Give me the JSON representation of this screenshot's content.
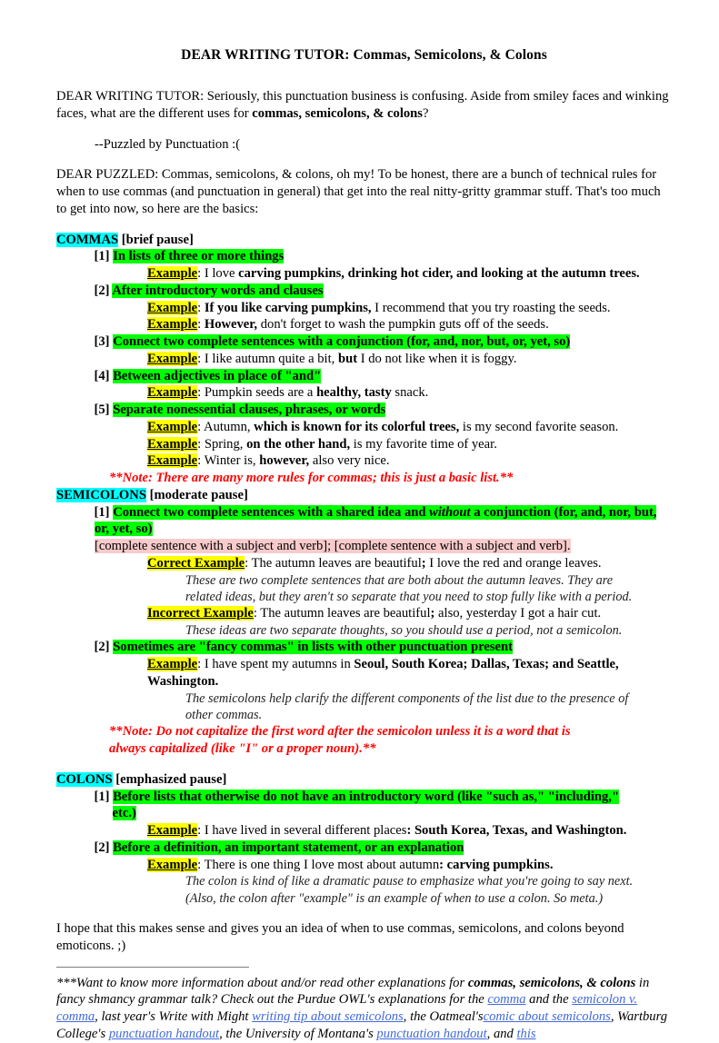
{
  "document": {
    "title": "DEAR WRITING TUTOR: Commas, Semicolons, & Colons",
    "intro": {
      "line1": "DEAR WRITING TUTOR: Seriously, this punctuation business is confusing.  Aside from smiley faces and winking faces, what are the different uses for ",
      "line1_bold": "commas, semicolons, & colons",
      "line1_end": "?",
      "signature": "--Puzzled by Punctuation :(",
      "answer": "DEAR PUZZLED: Commas, semicolons, & colons, oh my!  To be honest, there are a bunch of technical rules for when to use commas (and punctuation in general) that get into the real nitty-gritty grammar stuff.  That's too much to get into now, so here are the basics:"
    },
    "commas": {
      "heading": "COMMAS",
      "heading_suffix": " [brief pause]",
      "rules": [
        {
          "num": "[1]",
          "text": "In lists of three or more things",
          "examples": [
            {
              "label": "Example",
              "plain_pre": ": I love ",
              "bold": "carving pumpkins, drinking hot cider, and looking at the autumn trees.",
              "plain_post": ""
            }
          ]
        },
        {
          "num": "[2]",
          "text": "After introductory words and clauses",
          "examples": [
            {
              "label": "Example",
              "plain_pre": ": ",
              "bold": "If you like carving pumpkins,",
              "plain_post": " I recommend that you try roasting the seeds."
            },
            {
              "label": "Example",
              "plain_pre": ": ",
              "bold": "However,",
              "plain_post": " don't forget to wash the pumpkin guts off of the seeds."
            }
          ]
        },
        {
          "num": "[3]",
          "text": "Connect two complete sentences with a conjunction (for, and, nor, but, or, yet, so)",
          "examples": [
            {
              "label": "Example",
              "plain_pre": ": I like autumn quite a bit, ",
              "bold": "but",
              "plain_post": " I do not like when it is foggy."
            }
          ]
        },
        {
          "num": "[4]",
          "text": "Between adjectives in place of \"and\"",
          "examples": [
            {
              "label": "Example",
              "plain_pre": ": Pumpkin seeds are a ",
              "bold": "healthy, tasty",
              "plain_post": " snack."
            }
          ]
        },
        {
          "num": "[5]",
          "text": "Separate nonessential clauses, phrases, or words",
          "examples": [
            {
              "label": "Example",
              "plain_pre": ": Autumn, ",
              "bold": "which is known for its colorful trees,",
              "plain_post": " is my second favorite season."
            },
            {
              "label": "Example",
              "plain_pre": ": Spring, ",
              "bold": "on the other hand,",
              "plain_post": " is my favorite time of year."
            },
            {
              "label": "Example",
              "plain_pre": ": Winter is, ",
              "bold": "however,",
              "plain_post": " also very nice."
            }
          ]
        }
      ],
      "note": "**Note: There are many more rules for commas; this is just a basic list.**"
    },
    "semicolons": {
      "heading": "SEMICOLONS",
      "heading_suffix": " [moderate pause]",
      "rule1": {
        "num": "[1]",
        "text_pre": "Connect two complete sentences with a shared idea and ",
        "text_italic": "without",
        "text_post": " a conjunction (for, and, nor, but, or, yet, so)"
      },
      "formula": "[complete sentence with a subject and verb]; [complete sentence with a subject and verb].",
      "correct_label": "Correct Example",
      "correct_pre": ": The autumn leaves are beautiful",
      "correct_semi": ";",
      "correct_post": " I love the red and orange leaves.",
      "correct_expl_1": "These are two complete sentences that are both about the autumn leaves.  They are",
      "correct_expl_2": "related ideas, but they aren't so separate that you need to stop fully like with a period.",
      "incorrect_label": "Incorrect Example",
      "incorrect_pre": ": The autumn leaves are beautiful",
      "incorrect_semi": ";",
      "incorrect_post": " also, yesterday I got a hair cut.",
      "incorrect_expl": "These ideas are two separate thoughts, so you should use a period, not a semicolon.",
      "rule2": {
        "num": "[2]",
        "text": "Sometimes are \"fancy commas\" in lists with other punctuation present"
      },
      "rule2_example_label": "Example",
      "rule2_example_pre": ": I have spent my autumns in ",
      "rule2_example_bold_1": "Seoul, South Korea; Dallas, Texas; and Seattle,",
      "rule2_example_bold_2": "Washington.",
      "rule2_expl_1": "The semicolons help clarify the different components of the list due to the presence of",
      "rule2_expl_2": "other commas.",
      "note_1": "**Note: Do not capitalize the first word after the semicolon unless it is a word that is",
      "note_2": "always capitalized (like \"I\" or a proper noun).**"
    },
    "colons": {
      "heading": "COLONS",
      "heading_suffix": " [emphasized pause]",
      "rule1": {
        "num": "[1]",
        "text_line1": "Before lists that otherwise do not have an introductory word (like \"such as,\" \"including,\"",
        "text_line2": "etc.)"
      },
      "rule1_example_label": "Example",
      "rule1_example_pre": ": I have lived in several different places",
      "rule1_example_bold": ": South Korea, Texas, and Washington.",
      "rule2": {
        "num": "[2]",
        "text": "Before a definition, an important statement, or an explanation"
      },
      "rule2_example_label": "Example",
      "rule2_example_pre": ": There is one thing I love most about autumn",
      "rule2_example_bold": ": carving pumpkins.",
      "rule2_expl_1": "The colon is kind of like a dramatic pause to emphasize what you're going to say next.",
      "rule2_expl_2": "(Also, the colon after \"example\" is an example of when to use a colon.  So meta.)"
    },
    "closing": "I hope that this makes sense and gives you an idea of when to use commas, semicolons, and colons beyond emoticons. ;)",
    "footer": {
      "seg1": "***Want to know more information about and/or read other explanations for ",
      "bold1": "commas, semicolons, & colons",
      "seg2": " in fancy shmancy grammar talk?  Check out the Purdue OWL's explanations for the ",
      "link1": "comma",
      "seg3": " and the ",
      "link2": "semicolon v. comma",
      "seg4": ", last year's Write with Might ",
      "link3": "writing tip about semicolons",
      "seg5": ", the Oatmeal's",
      "link4": "comic about semicolons",
      "seg6": ", Wartburg College's ",
      "link5": "punctuation handout",
      "seg7": ", the University of Montana's ",
      "link6": "punctuation handout",
      "seg8": ", and ",
      "link7": "this"
    },
    "colors": {
      "highlight_cyan": "#00ffff",
      "highlight_green": "#00ff00",
      "highlight_yellow": "#ffff00",
      "highlight_pink": "#f7cbcb",
      "note_red": "#ff0000",
      "link_blue": "#4169d8"
    }
  }
}
